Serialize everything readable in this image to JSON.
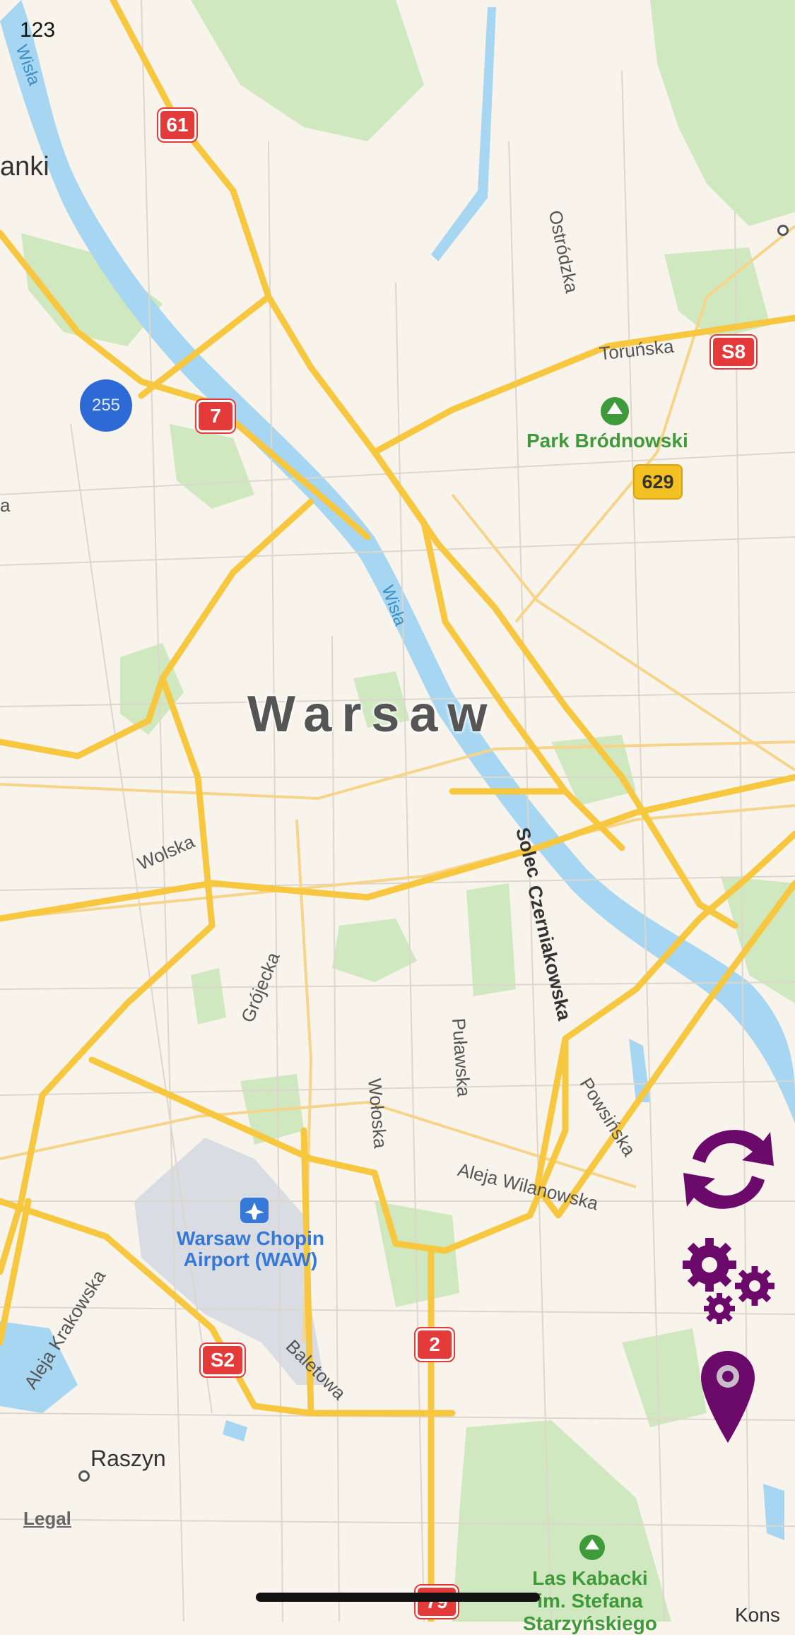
{
  "status_bar": {
    "label": "123"
  },
  "map": {
    "city": "Warsaw",
    "places": {
      "lomianki": "anki",
      "raszyn": "Raszyn",
      "left_edge": "a",
      "bottom_right": "Kons"
    },
    "parks": {
      "brodnowski": "Park Bródnowski",
      "kabacki": [
        "Las Kabacki",
        "im. Stefana",
        "Starzyńskiego"
      ]
    },
    "airport": [
      "Warsaw Chopin",
      "Airport (WAW)"
    ],
    "water": {
      "wisla_north": "Wisła",
      "wisla_center": "Wisła"
    },
    "streets": {
      "torunska": "Toruńska",
      "ostrodzka": "Ostródzka",
      "wolska": "Wolska",
      "grojecka": "Grójecka",
      "wołoska": "Wołoska",
      "pulawska": "Puławska",
      "solec": "Solec",
      "czerniakowska": "Czerniakowska",
      "powsinska": "Powsińska",
      "wilanowska": "Aleja Wilanowska",
      "krakowska": "Aleja Krakowska",
      "baletowa": "Baletowa"
    },
    "route_shields": {
      "r61": "61",
      "r7": "7",
      "s8": "S8",
      "r629": "629",
      "s2": "S2",
      "r2": "2",
      "r79": "79"
    },
    "cluster_count": "255",
    "legal": "Legal"
  },
  "controls": {
    "refresh": "refresh-icon",
    "settings": "gears-icon",
    "location": "map-pin-icon"
  },
  "colors": {
    "background": "#f8f4ec",
    "park": "#cfe8bf",
    "water": "#a6d6f2",
    "road_major": "#f7c740",
    "shield_red": "#e53a3a",
    "cluster": "#2e6ad6",
    "control_purple": "#6b0a6b"
  }
}
